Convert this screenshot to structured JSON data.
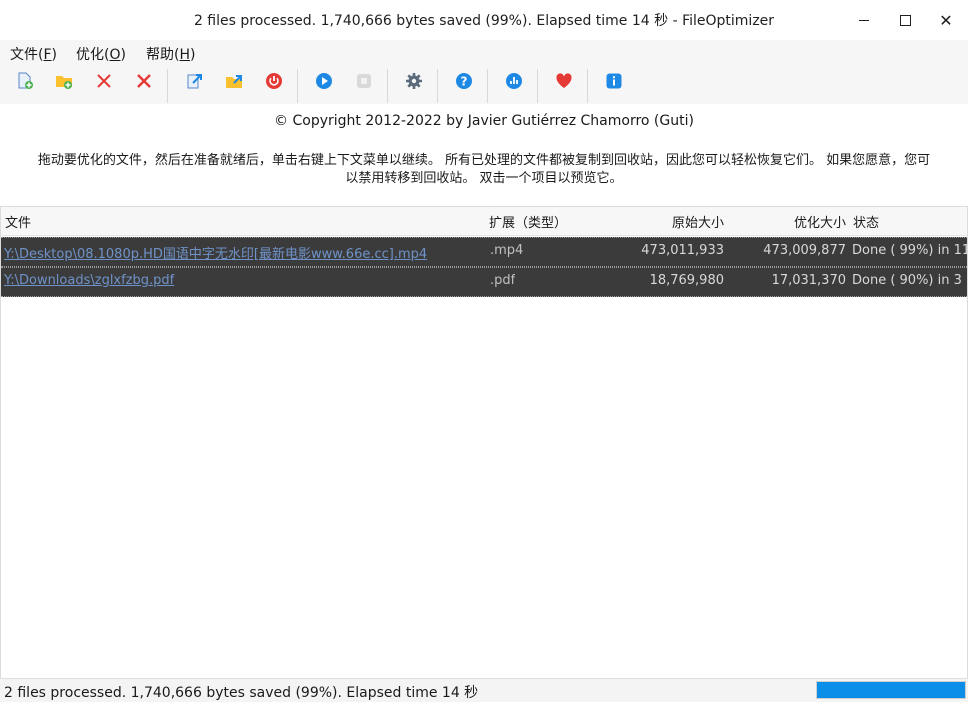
{
  "window": {
    "title": "2 files processed. 1,740,666 bytes saved (99%). Elapsed time 14 秒 - FileOptimizer",
    "minimize_icon": "minimize-icon",
    "maximize_icon": "maximize-icon",
    "close_glyph": "✕"
  },
  "menu": {
    "items": [
      {
        "label": "文件(",
        "key": "F",
        "suffix": ")"
      },
      {
        "label": "优化(",
        "key": "O",
        "suffix": ")"
      },
      {
        "label": "帮助(",
        "key": "H",
        "suffix": ")"
      }
    ]
  },
  "toolbar": {
    "buttons": [
      {
        "name": "add-files",
        "icon": "file-add-icon"
      },
      {
        "name": "add-folder",
        "icon": "folder-add-icon"
      },
      {
        "name": "remove-selected",
        "icon": "remove-icon"
      },
      {
        "name": "clear-list",
        "icon": "clear-icon"
      },
      {
        "name": "open",
        "icon": "open-file-icon"
      },
      {
        "name": "open-folder",
        "icon": "open-folder-icon"
      },
      {
        "name": "shutdown",
        "icon": "power-icon"
      },
      {
        "name": "optimize",
        "icon": "play-icon"
      },
      {
        "name": "stop",
        "icon": "stop-icon"
      },
      {
        "name": "options",
        "icon": "gear-icon"
      },
      {
        "name": "help",
        "icon": "help-icon"
      },
      {
        "name": "stats",
        "icon": "stats-icon"
      },
      {
        "name": "donate",
        "icon": "heart-icon"
      },
      {
        "name": "about",
        "icon": "info-icon"
      }
    ],
    "colors": {
      "green": "#4caf50",
      "red": "#e53935",
      "blue": "#1e88e5",
      "yellow": "#fbc02d",
      "gray": "#5b6b7b"
    }
  },
  "copyright": "© Copyright 2012-2022 by Javier Gutiérrez Chamorro (Guti)",
  "description": {
    "line1": "拖动要优化的文件，然后在准备就绪后，单击右键上下文菜单以继续。 所有已处理的文件都被复制到回收站，因此您可以轻松恢复它们。 如果您愿意，您可",
    "line2": "以禁用转移到回收站。 双击一个项目以预览它。"
  },
  "list": {
    "columns": {
      "file": "文件",
      "ext": "扩展（类型）",
      "original": "原始大小",
      "optimized": "优化大小",
      "status": "状态"
    },
    "rows": [
      {
        "file": "Y:\\Desktop\\08.1080p.HD国语中字无水印[最新电影www.66e.cc].mp4",
        "ext": ".mp4",
        "original": "473,011,933",
        "optimized": "473,009,877",
        "status": "Done ( 99%) in  11"
      },
      {
        "file": "Y:\\Downloads\\zglxfzbg.pdf",
        "ext": ".pdf",
        "original": "18,769,980",
        "optimized": "17,031,370",
        "status": "Done ( 90%) in  3"
      }
    ]
  },
  "statusbar": {
    "text": "2 files processed. 1,740,666 bytes saved (99%). Elapsed time  14 秒",
    "progress_fraction": 1.0,
    "progress_color": "#0a8ee8"
  }
}
